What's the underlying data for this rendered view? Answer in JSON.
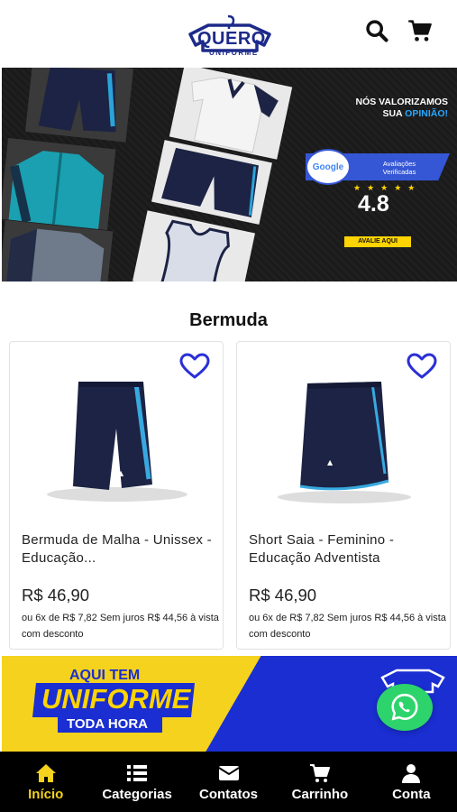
{
  "header": {
    "logo_text": "QUERO",
    "logo_subtext": "UNIFORME",
    "search_icon": "search-icon",
    "cart_icon": "cart-icon"
  },
  "hero": {
    "line1": "NÓS VALORIZAMOS",
    "line2_prefix": "SUA",
    "line2_highlight": "OPINIÃO!",
    "google_brand": "Google",
    "google_line1": "Avaliações",
    "google_line2": "Verificadas",
    "stars": "★★★★★",
    "rating": "4.8",
    "cta": "AVALIE AQUI"
  },
  "section": {
    "title": "Bermuda"
  },
  "products": [
    {
      "name": "Bermuda de Malha - Unissex - Educação...",
      "price": "R$ 46,90",
      "installments": "ou 6x de R$ 7,82 Sem juros R$ 44,56 à vista com desconto"
    },
    {
      "name": "Short Saia - Feminino - Educação Adventista",
      "price": "R$ 46,90",
      "installments": "ou 6x de R$ 7,82 Sem juros R$ 44,56 à vista com desconto"
    }
  ],
  "promo": {
    "line1": "AQUI TEM",
    "line2": "UNIFORME",
    "line3": "TODA HORA"
  },
  "nav": {
    "items": [
      {
        "label": "Início",
        "icon": "home-icon",
        "active": true
      },
      {
        "label": "Categorias",
        "icon": "list-icon",
        "active": false
      },
      {
        "label": "Contatos",
        "icon": "mail-icon",
        "active": false
      },
      {
        "label": "Carrinho",
        "icon": "cart-icon",
        "active": false
      },
      {
        "label": "Conta",
        "icon": "user-icon",
        "active": false
      }
    ]
  },
  "colors": {
    "brand_blue": "#1d2a8a",
    "accent_yellow": "#f5d21d",
    "heart_blue": "#2a2fd6",
    "whatsapp_green": "#2cd46b"
  }
}
